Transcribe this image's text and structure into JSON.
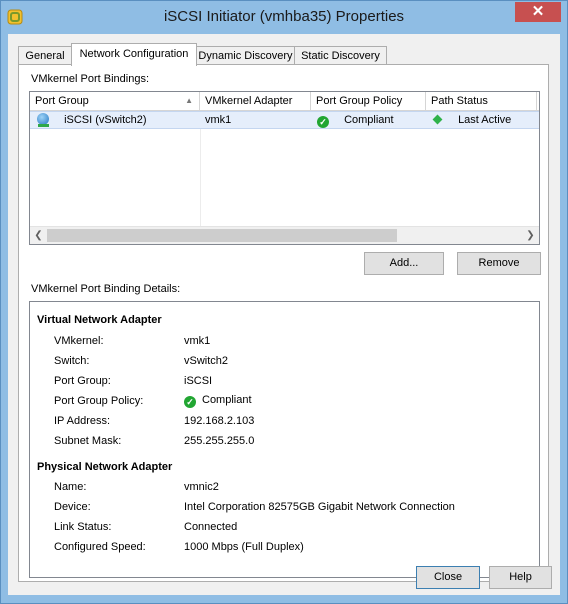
{
  "window": {
    "title": "iSCSI Initiator (vmhba35) Properties",
    "close_glyph": "✕"
  },
  "tabs": [
    {
      "label": "General"
    },
    {
      "label": "Network Configuration"
    },
    {
      "label": "Dynamic Discovery"
    },
    {
      "label": "Static Discovery"
    }
  ],
  "bindings": {
    "label": "VMkernel Port Bindings:",
    "columns": [
      "Port Group",
      "VMkernel Adapter",
      "Port Group Policy",
      "Path Status"
    ],
    "sorted_column": "Port Group",
    "rows": [
      {
        "port_group": "iSCSI (vSwitch2)",
        "vmkernel_adapter": "vmk1",
        "policy": "Compliant",
        "path_status": "Last Active"
      }
    ]
  },
  "buttons": {
    "add": "Add...",
    "remove": "Remove",
    "close": "Close",
    "help": "Help"
  },
  "details": {
    "label": "VMkernel Port Binding Details:",
    "virtual": {
      "heading": "Virtual Network Adapter",
      "items": [
        {
          "label": "VMkernel:",
          "value": "vmk1"
        },
        {
          "label": "Switch:",
          "value": "vSwitch2"
        },
        {
          "label": "Port Group:",
          "value": "iSCSI"
        },
        {
          "label": "Port Group Policy:",
          "value": "Compliant"
        },
        {
          "label": "IP Address:",
          "value": "192.168.2.103"
        },
        {
          "label": "Subnet Mask:",
          "value": "255.255.255.0"
        }
      ]
    },
    "physical": {
      "heading": "Physical Network Adapter",
      "items": [
        {
          "label": "Name:",
          "value": "vmnic2"
        },
        {
          "label": "Device:",
          "value": "Intel Corporation 82575GB Gigabit Network Connection"
        },
        {
          "label": "Link Status:",
          "value": "Connected"
        },
        {
          "label": "Configured Speed:",
          "value": "1000 Mbps (Full Duplex)"
        }
      ]
    }
  },
  "colors": {
    "title_bar": "#8fbde4",
    "close_button": "#c75050",
    "status_ok": "#22a632",
    "selection": "#e5eefb"
  }
}
